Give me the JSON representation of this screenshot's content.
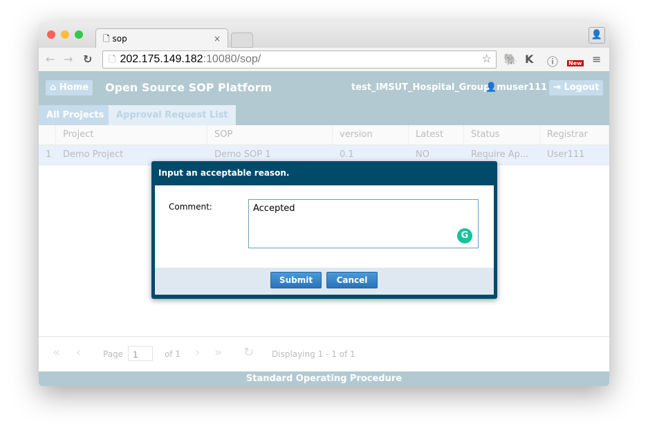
{
  "browser": {
    "tab_title": "sop",
    "url_host": "202.175.149.182",
    "url_rest": ":10080/sop/",
    "new_badge": "New"
  },
  "header": {
    "home": "Home",
    "title": "Open Source SOP Platform",
    "group": "test_IMSUT_Hospital_Group",
    "user": "muser111",
    "logout": "Logout"
  },
  "tabs": [
    {
      "label": "All Projects"
    },
    {
      "label": "Approval Request List"
    }
  ],
  "grid": {
    "columns": [
      "Project",
      "SOP",
      "version",
      "Latest",
      "Status",
      "Registrar"
    ],
    "rows": [
      {
        "num": "1",
        "cells": [
          "Demo Project",
          "Demo SOP 1",
          "0.1",
          "NO",
          "Require Ap...",
          "User111"
        ]
      }
    ]
  },
  "pager": {
    "page_label": "Page",
    "page_value": "1",
    "of": "of 1",
    "displaying": "Displaying 1 - 1 of 1"
  },
  "footer": "Standard Operating Procedure",
  "modal": {
    "title": "Input an acceptable reason.",
    "comment_label": "Comment:",
    "comment_value": "Accepted",
    "submit": "Submit",
    "cancel": "Cancel"
  }
}
